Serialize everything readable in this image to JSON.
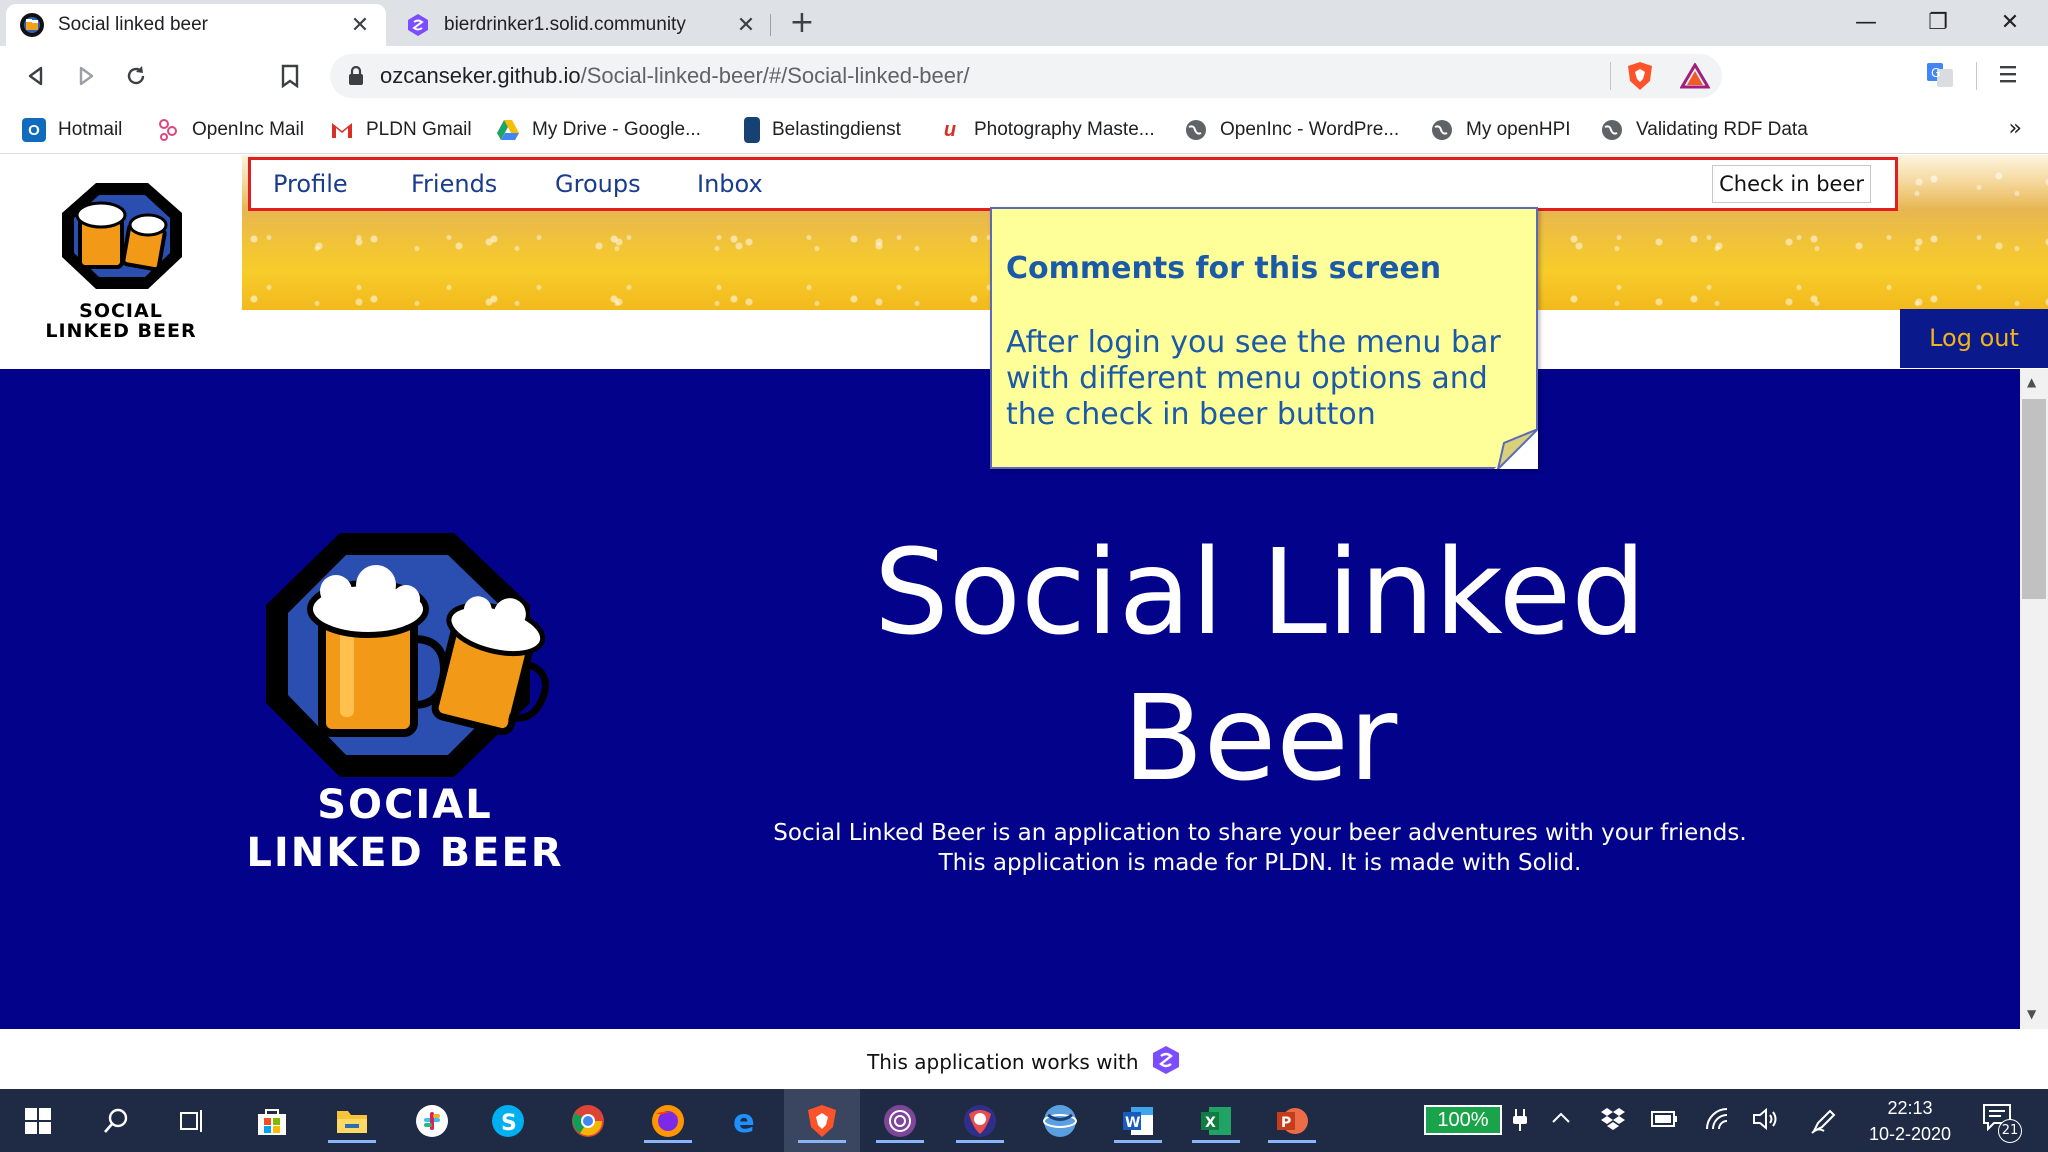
{
  "browser": {
    "tabs": [
      {
        "title": "Social linked beer",
        "active": true
      },
      {
        "title": "bierdrinker1.solid.community",
        "active": false
      }
    ],
    "close_glyph": "✕",
    "new_tab_glyph": "+",
    "window_controls": {
      "minimize": "—",
      "restore": "❐",
      "close": "✕"
    },
    "url_host": "ozcanseker.github.io",
    "url_path": "/Social-linked-beer/#/Social-linked-beer/",
    "bookmarks": [
      {
        "label": "Hotmail",
        "icon": "outlook-icon",
        "color": "#0f6cbd"
      },
      {
        "label": "OpenInc Mail",
        "icon": "openinc-mail-icon",
        "color": "#e0457b"
      },
      {
        "label": "PLDN Gmail",
        "icon": "gmail-icon",
        "color": "#d93025"
      },
      {
        "label": "My Drive - Google...",
        "icon": "google-drive-icon",
        "color": "#1fa463"
      },
      {
        "label": "Belastingdienst",
        "icon": "belastingdienst-icon",
        "color": "#154273"
      },
      {
        "label": "Photography Maste...",
        "icon": "photography-icon",
        "color": "#d93025"
      },
      {
        "label": "OpenInc - WordPre...",
        "icon": "globe-icon",
        "color": "#5f6368"
      },
      {
        "label": "My openHPI",
        "icon": "globe-icon",
        "color": "#5f6368"
      },
      {
        "label": "Validating RDF Data",
        "icon": "globe-icon",
        "color": "#5f6368"
      }
    ],
    "bookmarks_more": "»"
  },
  "app": {
    "logo_text_line1": "SOCIAL",
    "logo_text_line2": "LINKED BEER",
    "menu": {
      "items": [
        "Profile",
        "Friends",
        "Groups",
        "Inbox"
      ],
      "check_in_label": "Check in beer",
      "logout_label": "Log out"
    },
    "hero": {
      "title_line1": "Social Linked",
      "title_line2": "Beer",
      "description_line1": "Social Linked Beer is an application to share your beer adventures with your friends.",
      "description_line2": "This application is made for PLDN. It is made with Solid."
    },
    "footer_text": "This application works with"
  },
  "note": {
    "title": "Comments for this screen",
    "body": "After login you see the menu bar with different menu options and the check in beer button"
  },
  "taskbar": {
    "battery_label": "100%",
    "time": "22:13",
    "date": "10-2-2020",
    "notification_count": "21"
  },
  "colors": {
    "hero_bg": "#02028a",
    "menu_text": "#1a3c8c",
    "logout_text": "#f2b515",
    "highlight_border": "#e02020",
    "note_bg": "#ffff99",
    "note_text": "#1a5aa8"
  }
}
